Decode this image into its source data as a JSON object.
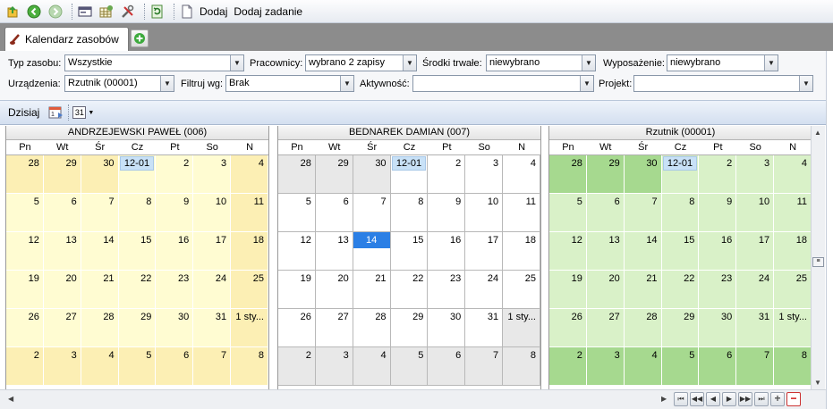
{
  "toolbar": {
    "add_label": "Dodaj",
    "add_task_label": "Dodaj zadanie"
  },
  "tabs": [
    {
      "label": "Kalendarz zasobów"
    }
  ],
  "filters": {
    "typ_zasobu": {
      "label": "Typ zasobu:",
      "value": "Wszystkie"
    },
    "pracownicy": {
      "label": "Pracownicy:",
      "value": "wybrano 2 zapisy"
    },
    "srodki_trwale": {
      "label": "Środki trwałe:",
      "value": "niewybrano"
    },
    "wyposazenie": {
      "label": "Wyposażenie:",
      "value": "niewybrano"
    },
    "urzadzenia": {
      "label": "Urządzenia:",
      "value": "Rzutnik (00001)"
    },
    "filtruj_wg": {
      "label": "Filtruj wg:",
      "value": "Brak"
    },
    "aktywnosc": {
      "label": "Aktywność:",
      "value": ""
    },
    "projekt": {
      "label": "Projekt:",
      "value": ""
    }
  },
  "nav": {
    "today_label": "Dzisiaj",
    "calendar_day": "31"
  },
  "weekdays": [
    "Pn",
    "Wt",
    "Śr",
    "Cz",
    "Pt",
    "So",
    "N"
  ],
  "calendars": [
    {
      "title": "ANDRZEJEWSKI PAWEŁ (006)",
      "colors": {
        "light": "#fffcd2",
        "dark": "#fcefb4"
      },
      "weeks": [
        [
          "28",
          "29",
          "30",
          "12-01",
          "2",
          "3",
          "4"
        ],
        [
          "5",
          "6",
          "7",
          "8",
          "9",
          "10",
          "11"
        ],
        [
          "12",
          "13",
          "14",
          "15",
          "16",
          "17",
          "18"
        ],
        [
          "19",
          "20",
          "21",
          "22",
          "23",
          "24",
          "25"
        ],
        [
          "26",
          "27",
          "28",
          "29",
          "30",
          "31",
          "1 sty..."
        ],
        [
          "2",
          "3",
          "4",
          "5",
          "6",
          "7",
          "8"
        ]
      ]
    },
    {
      "title": "BEDNAREK DAMIAN (007)",
      "colors": {
        "light": "#ffffff",
        "dark": "#e8e8e8"
      },
      "selected_day": "14",
      "weeks": [
        [
          "28",
          "29",
          "30",
          "12-01",
          "2",
          "3",
          "4"
        ],
        [
          "5",
          "6",
          "7",
          "8",
          "9",
          "10",
          "11"
        ],
        [
          "12",
          "13",
          "14",
          "15",
          "16",
          "17",
          "18"
        ],
        [
          "19",
          "20",
          "21",
          "22",
          "23",
          "24",
          "25"
        ],
        [
          "26",
          "27",
          "28",
          "29",
          "30",
          "31",
          "1 sty..."
        ],
        [
          "2",
          "3",
          "4",
          "5",
          "6",
          "7",
          "8"
        ]
      ]
    },
    {
      "title": "Rzutnik (00001)",
      "colors": {
        "light": "#d9f1c8",
        "dark": "#a6d98f"
      },
      "weeks": [
        [
          "28",
          "29",
          "30",
          "12-01",
          "2",
          "3",
          "4"
        ],
        [
          "5",
          "6",
          "7",
          "8",
          "9",
          "10",
          "11"
        ],
        [
          "12",
          "13",
          "14",
          "15",
          "16",
          "17",
          "18"
        ],
        [
          "19",
          "20",
          "21",
          "22",
          "23",
          "24",
          "25"
        ],
        [
          "26",
          "27",
          "28",
          "29",
          "30",
          "31",
          "1 sty..."
        ],
        [
          "2",
          "3",
          "4",
          "5",
          "6",
          "7",
          "8"
        ]
      ]
    }
  ]
}
